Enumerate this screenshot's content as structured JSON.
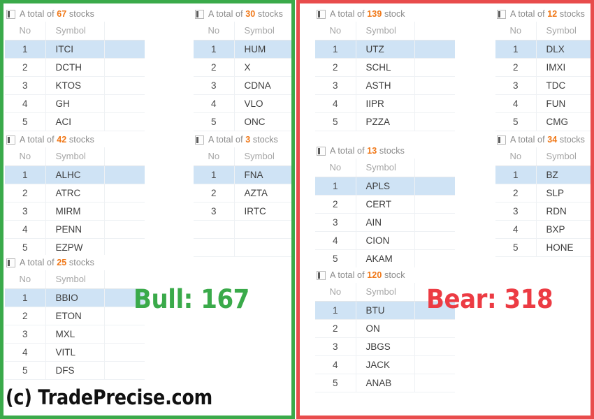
{
  "colors": {
    "bull_border": "#3aaa4a",
    "bear_border": "#e84c4c",
    "bull_text": "#3aaa4a",
    "bear_text": "#ec3b43",
    "count_accent": "#f07818",
    "row_selected": "#cfe3f5"
  },
  "table_headers": {
    "no": "No",
    "symbol": "Symbol"
  },
  "title_prefix": "A total of",
  "title_suffix": "stocks",
  "icon": "grid-icon",
  "bull_panel": {
    "summary_label": "Bull: 167",
    "blocks": [
      {
        "count": "67",
        "title_suffix": "stocks",
        "rows": [
          {
            "no": "1",
            "symbol": "ITCI"
          },
          {
            "no": "2",
            "symbol": "DCTH"
          },
          {
            "no": "3",
            "symbol": "KTOS"
          },
          {
            "no": "4",
            "symbol": "GH"
          },
          {
            "no": "5",
            "symbol": "ACI"
          }
        ]
      },
      {
        "count": "42",
        "title_suffix": "stocks",
        "rows": [
          {
            "no": "1",
            "symbol": "ALHC"
          },
          {
            "no": "2",
            "symbol": "ATRC"
          },
          {
            "no": "3",
            "symbol": "MIRM"
          },
          {
            "no": "4",
            "symbol": "PENN"
          },
          {
            "no": "5",
            "symbol": "EZPW"
          }
        ]
      },
      {
        "count": "25",
        "title_suffix": "stocks",
        "rows": [
          {
            "no": "1",
            "symbol": "BBIO"
          },
          {
            "no": "2",
            "symbol": "ETON"
          },
          {
            "no": "3",
            "symbol": "MXL"
          },
          {
            "no": "4",
            "symbol": "VITL"
          },
          {
            "no": "5",
            "symbol": "DFS"
          }
        ]
      },
      {
        "count": "30",
        "title_suffix": "stocks",
        "rows": [
          {
            "no": "1",
            "symbol": "HUM"
          },
          {
            "no": "2",
            "symbol": "X"
          },
          {
            "no": "3",
            "symbol": "CDNA"
          },
          {
            "no": "4",
            "symbol": "VLO"
          },
          {
            "no": "5",
            "symbol": "ONC"
          }
        ]
      },
      {
        "count": "3",
        "title_suffix": "stocks",
        "rows": [
          {
            "no": "1",
            "symbol": "FNA"
          },
          {
            "no": "2",
            "symbol": "AZTA"
          },
          {
            "no": "3",
            "symbol": "IRTC"
          },
          {
            "no": "",
            "symbol": ""
          },
          {
            "no": "",
            "symbol": ""
          }
        ]
      }
    ]
  },
  "bear_panel": {
    "summary_label": "Bear: 318",
    "blocks": [
      {
        "count": "139",
        "title_suffix": "stock",
        "rows": [
          {
            "no": "1",
            "symbol": "UTZ"
          },
          {
            "no": "2",
            "symbol": "SCHL"
          },
          {
            "no": "3",
            "symbol": "ASTH"
          },
          {
            "no": "4",
            "symbol": "IIPR"
          },
          {
            "no": "5",
            "symbol": "PZZA"
          }
        ]
      },
      {
        "count": "13",
        "title_suffix": "stocks",
        "rows": [
          {
            "no": "1",
            "symbol": "APLS"
          },
          {
            "no": "2",
            "symbol": "CERT"
          },
          {
            "no": "3",
            "symbol": "AIN"
          },
          {
            "no": "4",
            "symbol": "CION"
          },
          {
            "no": "5",
            "symbol": "AKAM"
          }
        ]
      },
      {
        "count": "120",
        "title_suffix": "stock",
        "rows": [
          {
            "no": "1",
            "symbol": "BTU"
          },
          {
            "no": "2",
            "symbol": "ON"
          },
          {
            "no": "3",
            "symbol": "JBGS"
          },
          {
            "no": "4",
            "symbol": "JACK"
          },
          {
            "no": "5",
            "symbol": "ANAB"
          }
        ]
      },
      {
        "count": "12",
        "title_suffix": "stocks",
        "rows": [
          {
            "no": "1",
            "symbol": "DLX"
          },
          {
            "no": "2",
            "symbol": "IMXI"
          },
          {
            "no": "3",
            "symbol": "TDC"
          },
          {
            "no": "4",
            "symbol": "FUN"
          },
          {
            "no": "5",
            "symbol": "CMG"
          }
        ]
      },
      {
        "count": "34",
        "title_suffix": "stocks",
        "rows": [
          {
            "no": "1",
            "symbol": "BZ"
          },
          {
            "no": "2",
            "symbol": "SLP"
          },
          {
            "no": "3",
            "symbol": "RDN"
          },
          {
            "no": "4",
            "symbol": "BXP"
          },
          {
            "no": "5",
            "symbol": "HONE"
          }
        ]
      }
    ]
  },
  "watermark": "(c) TradePrecise.com"
}
